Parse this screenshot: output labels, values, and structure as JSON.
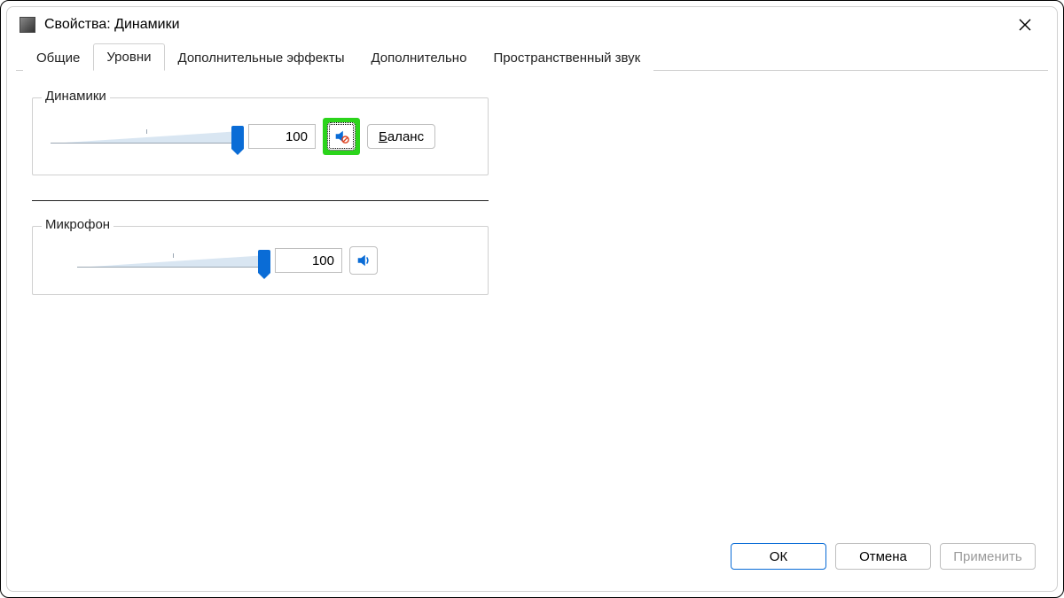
{
  "window": {
    "title": "Свойства: Динамики"
  },
  "tabs": {
    "general": "Общие",
    "levels": "Уровни",
    "effects": "Дополнительные эффекты",
    "advanced": "Дополнительно",
    "spatial": "Пространственный звук"
  },
  "speakers": {
    "label": "Динамики",
    "value": "100",
    "balance": "Баланс",
    "muted": true
  },
  "microphone": {
    "label": "Микрофон",
    "value": "100",
    "muted": false
  },
  "buttons": {
    "ok": "ОК",
    "cancel": "Отмена",
    "apply": "Применить"
  }
}
